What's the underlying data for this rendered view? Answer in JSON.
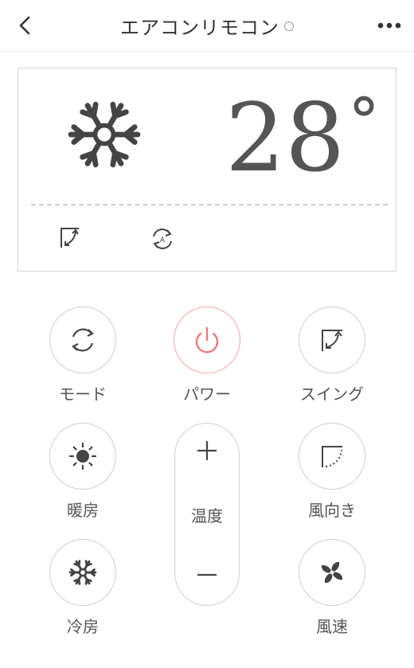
{
  "header": {
    "title": "エアコンリモコン"
  },
  "display": {
    "temperature": "28",
    "degree": "°"
  },
  "buttons": {
    "mode": "モード",
    "power": "パワー",
    "swing": "スイング",
    "heat": "暖房",
    "temperature": "温度",
    "direction": "風向き",
    "cool": "冷房",
    "speed": "風速"
  },
  "colors": {
    "accent_power": "#f07b7b",
    "icon": "#444444",
    "border": "#cfcfcf"
  }
}
